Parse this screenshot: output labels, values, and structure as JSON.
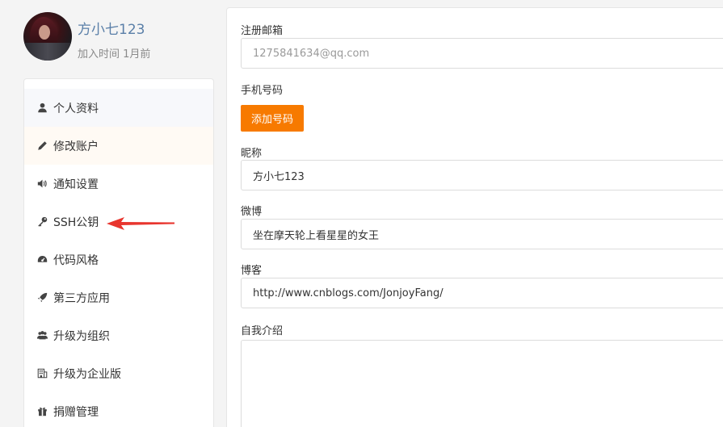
{
  "profile": {
    "username": "方小七123",
    "join_time": "加入时间 1月前"
  },
  "sidebar": {
    "items": [
      {
        "label": "个人资料",
        "icon": "user-icon"
      },
      {
        "label": "修改账户",
        "icon": "pencil-icon"
      },
      {
        "label": "通知设置",
        "icon": "volume-icon"
      },
      {
        "label": "SSH公钥",
        "icon": "key-icon"
      },
      {
        "label": "代码风格",
        "icon": "dashboard-icon"
      },
      {
        "label": "第三方应用",
        "icon": "rocket-icon"
      },
      {
        "label": "升级为组织",
        "icon": "users-icon"
      },
      {
        "label": "升级为企业版",
        "icon": "building-icon"
      },
      {
        "label": "捐赠管理",
        "icon": "gift-icon"
      }
    ]
  },
  "form": {
    "email": {
      "label": "注册邮箱",
      "value": "1275841634@qq.com"
    },
    "phone": {
      "label": "手机号码",
      "button": "添加号码"
    },
    "nickname": {
      "label": "昵称",
      "value": "方小七123"
    },
    "weibo": {
      "label": "微博",
      "value": "坐在摩天轮上看星星的女王"
    },
    "blog": {
      "label": "博客",
      "value": "http://www.cnblogs.com/JonjoyFang/"
    },
    "bio": {
      "label": "自我介绍",
      "value": ""
    }
  },
  "colors": {
    "accent": "#f77a00",
    "arrow": "#e8352e",
    "username": "#5a7fa8"
  }
}
